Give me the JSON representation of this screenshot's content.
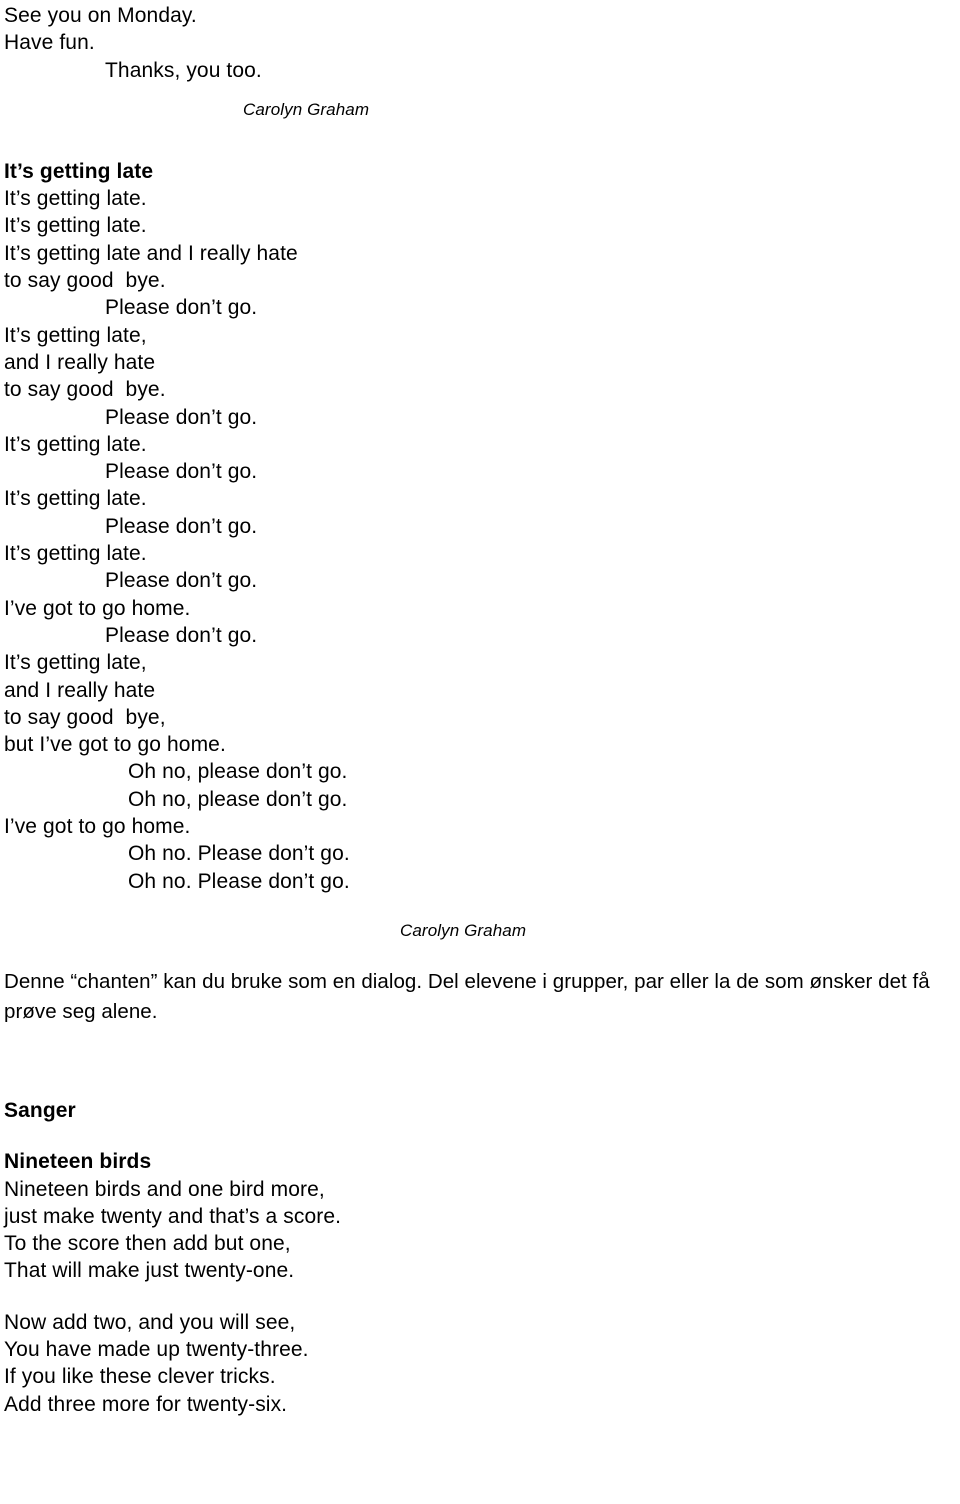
{
  "document": {
    "dialogue_close": {
      "lines": [
        {
          "text": "See you on Monday.",
          "indent": 0
        },
        {
          "text": "Have fun.",
          "indent": 0
        },
        {
          "text": "Thanks, you too.",
          "indent": 1
        }
      ]
    },
    "attribution_1": "Carolyn Graham",
    "chant": {
      "title": "It’s getting late",
      "lines": [
        {
          "text": "It’s getting late.",
          "indent": 0
        },
        {
          "text": "It’s getting late.",
          "indent": 0
        },
        {
          "text": "It’s getting late and I really hate",
          "indent": 0
        },
        {
          "text": "to say good  bye.",
          "indent": 0
        },
        {
          "text": "Please don’t go.",
          "indent": 1
        },
        {
          "text": "It’s getting late,",
          "indent": 0
        },
        {
          "text": "and I really hate",
          "indent": 0
        },
        {
          "text": "to say good  bye.",
          "indent": 0
        },
        {
          "text": "Please don’t go.",
          "indent": 1
        },
        {
          "text": "It’s getting late.",
          "indent": 0
        },
        {
          "text": "Please don’t go.",
          "indent": 1
        },
        {
          "text": "It’s getting late.",
          "indent": 0
        },
        {
          "text": "Please don’t go.",
          "indent": 1
        },
        {
          "text": "It’s getting late.",
          "indent": 0
        },
        {
          "text": "Please don’t go.",
          "indent": 1
        },
        {
          "text": "I’ve got to go home.",
          "indent": 0
        },
        {
          "text": "Please don’t go.",
          "indent": 1
        },
        {
          "text": "It’s getting late,",
          "indent": 0
        },
        {
          "text": "and I really hate",
          "indent": 0
        },
        {
          "text": "to say good  bye,",
          "indent": 0
        },
        {
          "text": "but I’ve got to go home.",
          "indent": 0
        },
        {
          "text": "Oh no, please don’t go.",
          "indent": 2
        },
        {
          "text": "Oh no, please don’t go.",
          "indent": 2
        },
        {
          "text": "I’ve got to go home.",
          "indent": 0
        },
        {
          "text": "Oh no. Please don’t go.",
          "indent": 2
        },
        {
          "text": "Oh no. Please don’t go.",
          "indent": 2
        }
      ]
    },
    "attribution_2": "Carolyn Graham",
    "note_no": "Denne “chanten” kan du bruke som en dialog. Del elevene i grupper, par eller la de som ønsker det få prøve seg alene.",
    "songs_heading": "Sanger",
    "song": {
      "title": "Nineteen birds",
      "verse_1": [
        "Nineteen birds and one bird more,",
        "just make twenty and that’s a score.",
        "To the score then add but one,",
        "That will make just twenty-one."
      ],
      "verse_2": [
        "Now add two, and you will see,",
        "You have made up twenty-three.",
        "If you like these clever tricks.",
        "Add three more for twenty-six."
      ]
    }
  }
}
